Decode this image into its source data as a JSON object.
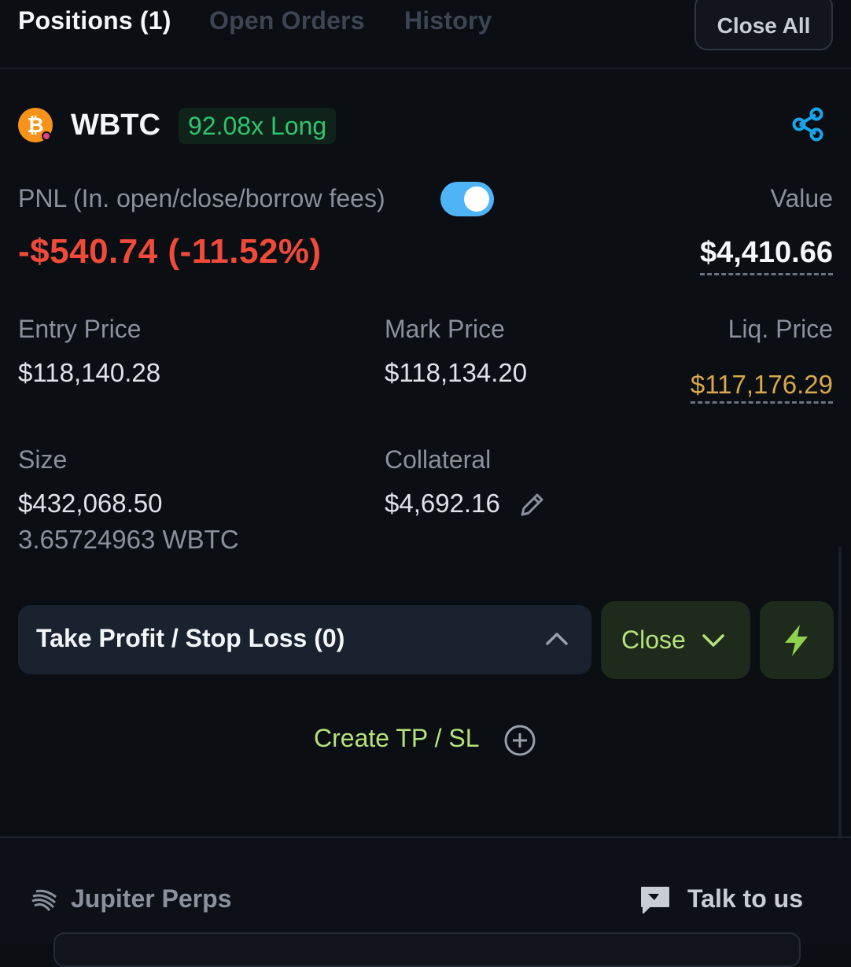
{
  "tabs": {
    "positions": "Positions (1)",
    "open_orders": "Open Orders",
    "history": "History",
    "close_all": "Close All"
  },
  "position": {
    "market": "WBTC",
    "leverage_badge": "92.08x Long",
    "pnl_label": "PNL (In. open/close/borrow fees)",
    "pnl_toggle_on": true,
    "pnl_value": "-$540.74 (-11.52%)",
    "value_label": "Value",
    "value_amount": "$4,410.66",
    "entry_price_label": "Entry Price",
    "entry_price": "$118,140.28",
    "mark_price_label": "Mark Price",
    "mark_price": "$118,134.20",
    "liq_price_label": "Liq. Price",
    "liq_price": "$117,176.29",
    "size_label": "Size",
    "size_usd": "$432,068.50",
    "size_token": "3.65724963 WBTC",
    "collateral_label": "Collateral",
    "collateral": "$4,692.16"
  },
  "actions": {
    "tpsl_label": "Take Profit / Stop Loss (0)",
    "close_label": "Close",
    "create_tpsl": "Create TP / SL"
  },
  "footer": {
    "brand": "Jupiter Perps",
    "talk": "Talk to us"
  },
  "colors": {
    "background": "#0b0e13",
    "pnl_negative": "#f04a3a",
    "long_green": "#2fc46d",
    "liq_orange": "#d6a84a",
    "accent_lime": "#b6e27a",
    "toggle_blue": "#4fb4f5",
    "share_blue": "#1aa3e8"
  },
  "icons": {
    "coin": "bitcoin-icon",
    "share": "share-icon",
    "edit": "pencil-icon",
    "tpsl_chevron": "chevron-up-icon",
    "close_chevron": "chevron-down-icon",
    "instant": "lightning-icon",
    "create": "plus-circle-icon",
    "brand": "jupiter-logo-icon",
    "chat": "chat-icon"
  }
}
